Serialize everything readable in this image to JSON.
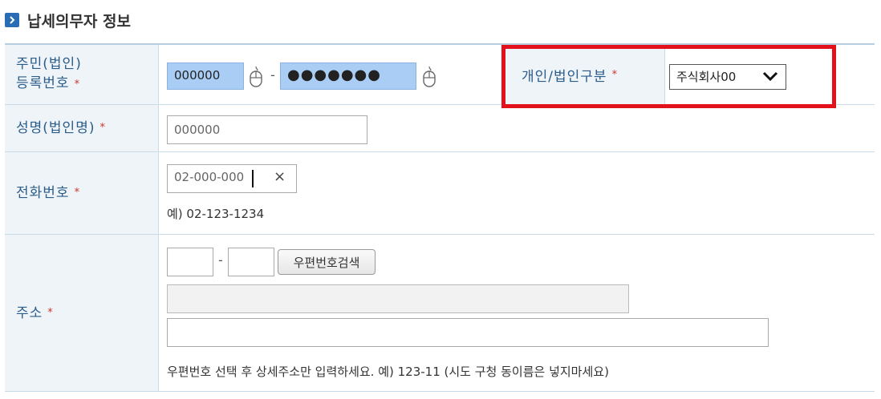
{
  "section": {
    "title": "납세의무자 정보"
  },
  "fields": {
    "resident_number": {
      "label_line1": "주민(법인)",
      "label_line2": "등록번호",
      "required_mark": "*",
      "front_value": "000000",
      "separator": "-",
      "back_value": "●●●●●●●"
    },
    "entity_type": {
      "label": "개인/법인구분",
      "required_mark": "*",
      "selected": "주식회사00"
    },
    "name": {
      "label": "성명(법인명)",
      "required_mark": "*",
      "value": "000000"
    },
    "phone": {
      "label": "전화번호",
      "required_mark": "*",
      "value": "02-000-000",
      "clear_symbol": "×",
      "example": "예) 02-123-1234"
    },
    "address": {
      "label": "주소",
      "required_mark": "*",
      "separator": "-",
      "search_button": "우편번호검색",
      "hint": "우편번호 선택 후 상세주소만 입력하세요. 예) 123-11 (시도 구청 동이름은 넣지마세요)"
    }
  },
  "colors": {
    "highlight_box": "#e3111b",
    "input_highlight": "#a9cdf5",
    "label_bg": "#eef4f8",
    "label_text": "#2b5c8a"
  }
}
